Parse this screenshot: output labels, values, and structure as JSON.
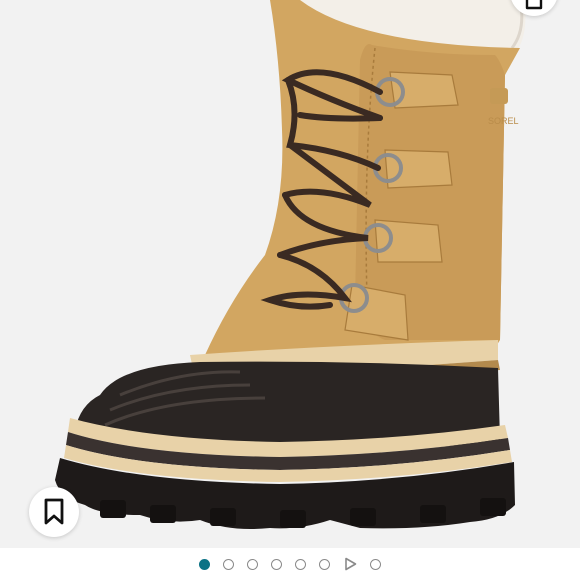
{
  "product_image": {
    "alt": "",
    "brand_mark": "SOREL"
  },
  "actions": {
    "bookmark_icon": "bookmark-icon",
    "share_icon": "share-icon"
  },
  "pager": {
    "total": 8,
    "active_index": 0,
    "video_index": 6,
    "active_color": "#0b7285",
    "inactive_color": "#8a8a8a"
  },
  "colors": {
    "boot_tan": "#d2a661",
    "rubber_dark": "#2a2523",
    "lace": "#3a2a22",
    "stripe": "#e8d2a8"
  }
}
